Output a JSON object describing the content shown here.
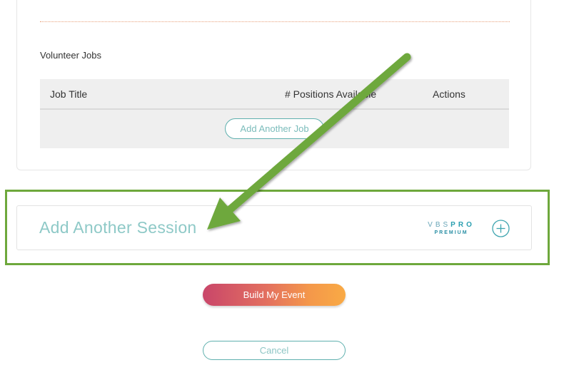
{
  "volunteer_jobs": {
    "section_label": "Volunteer Jobs",
    "columns": {
      "job_title": "Job Title",
      "positions": "# Positions Available",
      "actions": "Actions"
    },
    "add_job_label": "Add Another Job"
  },
  "session": {
    "add_session_label": "Add Another Session",
    "logo": {
      "vbs": "VBS",
      "pro": "PRO",
      "premium": "PREMIUM"
    },
    "add_icon": "plus-circle-icon"
  },
  "actions": {
    "build_label": "Build My Event",
    "cancel_label": "Cancel"
  },
  "colors": {
    "highlight": "#6ea83c",
    "arrow": "#6ea83c",
    "accent_teal": "#5fb0ae",
    "build_gradient_start": "#c9466a",
    "build_gradient_end": "#f9aa45"
  }
}
